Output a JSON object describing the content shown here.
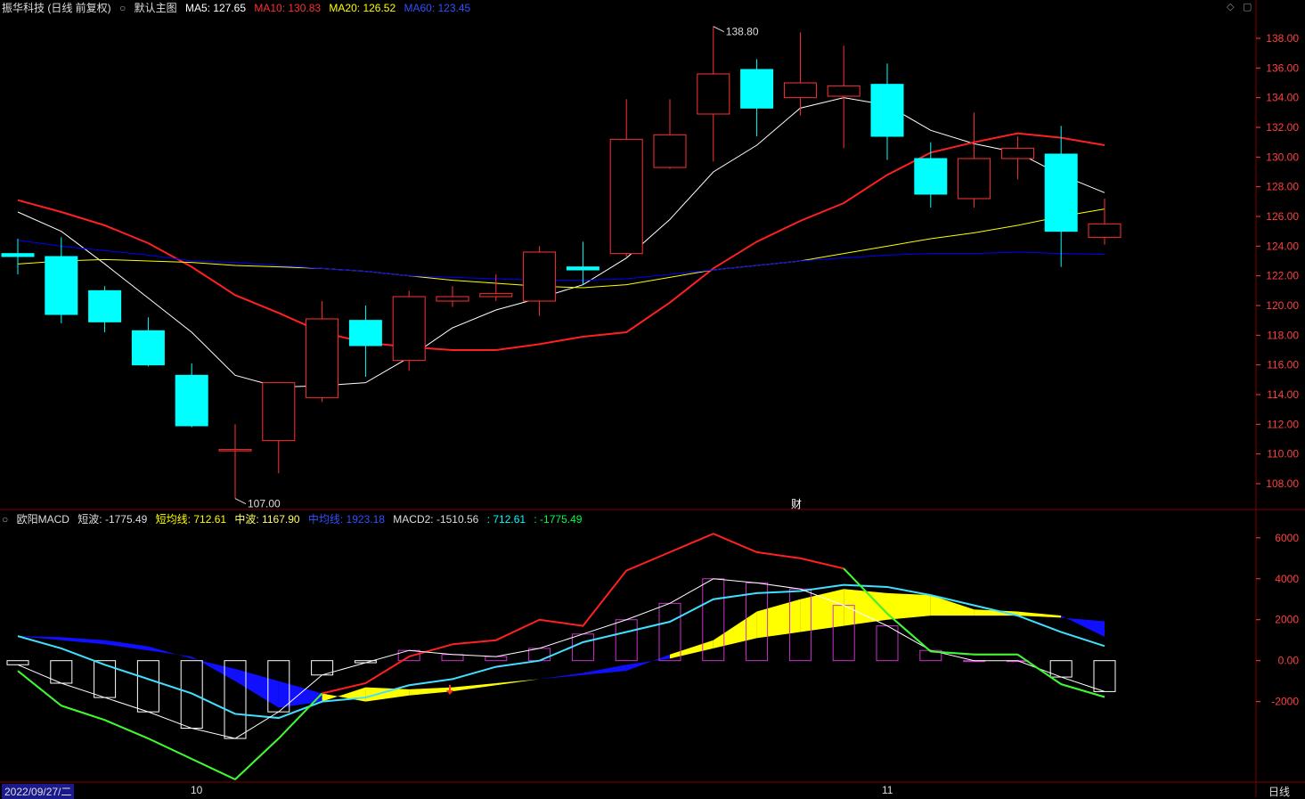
{
  "header_main": {
    "stock": "振华科技 (日线 前复权)",
    "template": "默认主图",
    "ma5": "MA5: 127.65",
    "ma10": "MA10: 130.83",
    "ma20": "MA20: 126.52",
    "ma60": "MA60: 123.45"
  },
  "header_sub": {
    "name": "欧阳MACD",
    "short": "短波: -1775.49",
    "short_avg": "短均线: 712.61",
    "mid": "中波: 1167.90",
    "mid_avg": "中均线: 1923.18",
    "macd2": "MACD2: -1510.56",
    "extra1": ": 712.61",
    "extra2": ": -1775.49"
  },
  "footer": {
    "date": "2022/09/27/二",
    "month10": "10",
    "month11": "11",
    "period": "日线"
  },
  "marker_cai": "财",
  "colors": {
    "up": "#ff3232",
    "down": "#00ffff",
    "ma5": "#ffffff",
    "ma10": "#ff2020",
    "ma20": "#ffff00",
    "ma60": "#0000ff",
    "grid": "#800000",
    "axis": "#ff4040"
  },
  "chart_data": [
    {
      "type": "candlestick",
      "title": "振华科技 (日线 前复权)",
      "y_ticks": [
        108.0,
        110.0,
        112.0,
        114.0,
        116.0,
        118.0,
        120.0,
        122.0,
        124.0,
        126.0,
        128.0,
        130.0,
        132.0,
        134.0,
        136.0,
        138.0
      ],
      "ylim": [
        106.5,
        139.5
      ],
      "annotations": [
        {
          "label": "138.80",
          "index": 16
        },
        {
          "label": "107.00",
          "index": 5
        }
      ],
      "candles": [
        {
          "o": 123.5,
          "c": 123.3,
          "h": 124.5,
          "l": 122.1
        },
        {
          "o": 123.3,
          "c": 119.4,
          "h": 124.6,
          "l": 118.8
        },
        {
          "o": 121.0,
          "c": 118.9,
          "h": 121.3,
          "l": 118.2
        },
        {
          "o": 118.3,
          "c": 116.0,
          "h": 119.2,
          "l": 115.9
        },
        {
          "o": 115.3,
          "c": 111.9,
          "h": 116.1,
          "l": 111.8
        },
        {
          "o": 110.3,
          "c": 110.3,
          "h": 112.0,
          "l": 107.0
        },
        {
          "o": 110.9,
          "c": 114.8,
          "h": 114.8,
          "l": 108.7
        },
        {
          "o": 113.8,
          "c": 119.1,
          "h": 120.3,
          "l": 113.5
        },
        {
          "o": 119.0,
          "c": 117.3,
          "h": 120.0,
          "l": 115.2
        },
        {
          "o": 116.3,
          "c": 120.6,
          "h": 121.0,
          "l": 115.6
        },
        {
          "o": 120.3,
          "c": 120.6,
          "h": 121.3,
          "l": 119.9
        },
        {
          "o": 120.6,
          "c": 120.8,
          "h": 122.1,
          "l": 120.3
        },
        {
          "o": 120.3,
          "c": 123.6,
          "h": 124.0,
          "l": 119.3
        },
        {
          "o": 122.6,
          "c": 122.4,
          "h": 124.3,
          "l": 121.4
        },
        {
          "o": 123.5,
          "c": 131.2,
          "h": 133.9,
          "l": 123.3
        },
        {
          "o": 129.3,
          "c": 131.5,
          "h": 133.9,
          "l": 129.2
        },
        {
          "o": 132.9,
          "c": 135.6,
          "h": 138.8,
          "l": 129.7
        },
        {
          "o": 135.9,
          "c": 133.3,
          "h": 136.6,
          "l": 131.4
        },
        {
          "o": 134.0,
          "c": 135.0,
          "h": 138.4,
          "l": 132.8
        },
        {
          "o": 134.1,
          "c": 134.8,
          "h": 137.5,
          "l": 130.6
        },
        {
          "o": 134.9,
          "c": 131.4,
          "h": 136.3,
          "l": 129.8
        },
        {
          "o": 129.9,
          "c": 127.5,
          "h": 131.0,
          "l": 126.6
        },
        {
          "o": 127.2,
          "c": 129.9,
          "h": 133.0,
          "l": 126.6
        },
        {
          "o": 129.9,
          "c": 130.6,
          "h": 131.4,
          "l": 128.5
        },
        {
          "o": 130.2,
          "c": 125.0,
          "h": 132.1,
          "l": 122.6
        },
        {
          "o": 124.6,
          "c": 125.5,
          "h": 127.2,
          "l": 124.1
        }
      ],
      "series": [
        {
          "name": "MA5",
          "values": [
            126.3,
            125.0,
            122.8,
            120.5,
            118.2,
            115.3,
            114.5,
            114.6,
            114.8,
            116.5,
            118.5,
            119.7,
            120.5,
            121.4,
            123.2,
            125.8,
            129.0,
            130.8,
            133.3,
            134.0,
            133.5,
            131.8,
            130.9,
            130.3,
            128.8,
            127.6
          ]
        },
        {
          "name": "MA10",
          "values": [
            127.1,
            126.3,
            125.4,
            124.2,
            122.6,
            120.7,
            119.5,
            118.2,
            117.5,
            117.2,
            117.0,
            117.0,
            117.4,
            117.9,
            118.2,
            120.2,
            122.5,
            124.3,
            125.7,
            126.9,
            128.8,
            130.3,
            131.0,
            131.6,
            131.3,
            130.8
          ]
        },
        {
          "name": "MA20",
          "values": [
            122.8,
            123.0,
            123.1,
            123.0,
            122.9,
            122.7,
            122.6,
            122.5,
            122.3,
            122.0,
            121.7,
            121.5,
            121.3,
            121.2,
            121.4,
            121.9,
            122.4,
            122.7,
            123.0,
            123.5,
            124.0,
            124.5,
            124.9,
            125.4,
            126.0,
            126.5
          ]
        },
        {
          "name": "MA60",
          "values": [
            124.4,
            124.0,
            123.7,
            123.4,
            123.0,
            122.9,
            122.7,
            122.5,
            122.3,
            122.0,
            121.9,
            121.8,
            121.7,
            121.7,
            121.8,
            122.1,
            122.4,
            122.7,
            123.0,
            123.2,
            123.4,
            123.5,
            123.5,
            123.6,
            123.5,
            123.45
          ]
        }
      ]
    },
    {
      "type": "line",
      "title": "欧阳MACD",
      "y_ticks": [
        6000,
        4000,
        2000,
        0.0,
        -2000
      ],
      "y_tick_labels": [
        "6000",
        "4000",
        "2000",
        "0.00",
        "-2000"
      ],
      "ylim": [
        -5800,
        6600
      ],
      "x": [
        0,
        1,
        2,
        3,
        4,
        5,
        6,
        7,
        8,
        9,
        10,
        11,
        12,
        13,
        14,
        15,
        16,
        17,
        18,
        19,
        20,
        21,
        22,
        23,
        24,
        25
      ],
      "series": [
        {
          "name": "短波",
          "values": [
            -500,
            -2200,
            -2900,
            -3800,
            -4800,
            -5800,
            -3800,
            -1600,
            -1100,
            200,
            800,
            1000,
            2000,
            1700,
            4400,
            5300,
            6200,
            5300,
            5000,
            4500,
            2300,
            450,
            300,
            300,
            -1150,
            -1775
          ]
        },
        {
          "name": "短均线",
          "values": [
            1200,
            600,
            -200,
            -900,
            -1600,
            -2600,
            -2800,
            -2000,
            -1800,
            -1200,
            -900,
            -300,
            0,
            900,
            1400,
            1900,
            3000,
            3300,
            3400,
            3700,
            3600,
            3200,
            2700,
            2200,
            1400,
            712
          ]
        },
        {
          "name": "中波",
          "values": [
            1200,
            1000,
            800,
            500,
            200,
            -1000,
            -2300,
            -2000,
            -1300,
            -1400,
            -1300,
            -1100,
            -900,
            -700,
            -500,
            300,
            1000,
            2400,
            3000,
            3500,
            3300,
            3200,
            2500,
            2400,
            2200,
            1168
          ]
        },
        {
          "name": "中均线",
          "values": [
            1200,
            1150,
            1000,
            700,
            100,
            -400,
            -1000,
            -1600,
            -2000,
            -1700,
            -1500,
            -1200,
            -900,
            -600,
            -200,
            100,
            600,
            1100,
            1400,
            1700,
            2000,
            2200,
            2200,
            2200,
            2100,
            1923
          ]
        },
        {
          "name": "MACD2",
          "values": [
            -200,
            -1100,
            -1800,
            -2500,
            -3300,
            -3800,
            -2500,
            -700,
            -100,
            500,
            300,
            200,
            600,
            1300,
            2000,
            2800,
            4000,
            3800,
            3500,
            2700,
            1700,
            500,
            0,
            0,
            -800,
            -1510
          ]
        }
      ],
      "histogram": [
        -200,
        -1100,
        -1800,
        -2500,
        -3300,
        -3800,
        -2500,
        -700,
        -100,
        500,
        300,
        200,
        600,
        1300,
        2000,
        2800,
        4000,
        3800,
        3500,
        2700,
        1700,
        500,
        0,
        0,
        -800,
        -1510
      ]
    }
  ]
}
